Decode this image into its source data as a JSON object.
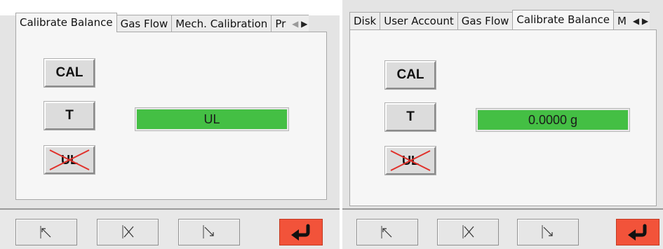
{
  "left_screen": {
    "tabs": [
      {
        "label": "Calibrate Balance",
        "active": true
      },
      {
        "label": "Gas Flow",
        "active": false
      },
      {
        "label": "Mech. Calibration",
        "active": false
      },
      {
        "label": "Pr",
        "active": false
      }
    ],
    "buttons": {
      "cal": "CAL",
      "tare": "T",
      "unload": "UL"
    },
    "display_value": "UL"
  },
  "right_screen": {
    "tabs": [
      {
        "label": "Disk",
        "active": false
      },
      {
        "label": "User Account",
        "active": false
      },
      {
        "label": "Gas Flow",
        "active": false
      },
      {
        "label": "Calibrate Balance",
        "active": true
      },
      {
        "label": "M",
        "active": false
      }
    ],
    "buttons": {
      "cal": "CAL",
      "tare": "T",
      "unload": "UL"
    },
    "display_value": "0.0000 g"
  },
  "icons": {
    "tab_scroll_left": "triangle-left-icon",
    "tab_scroll_right": "triangle-right-icon",
    "nav_up_left": "arrow-up-left-icon",
    "nav_converge": "arrows-converge-icon",
    "nav_down_right": "arrow-down-right-icon",
    "back": "return-arrow-icon",
    "unload_disabled": "red-x-cross-icon"
  },
  "colors": {
    "display_green": "#44bf44",
    "back_button": "#f2533a",
    "disabled_cross": "#e0302a"
  }
}
